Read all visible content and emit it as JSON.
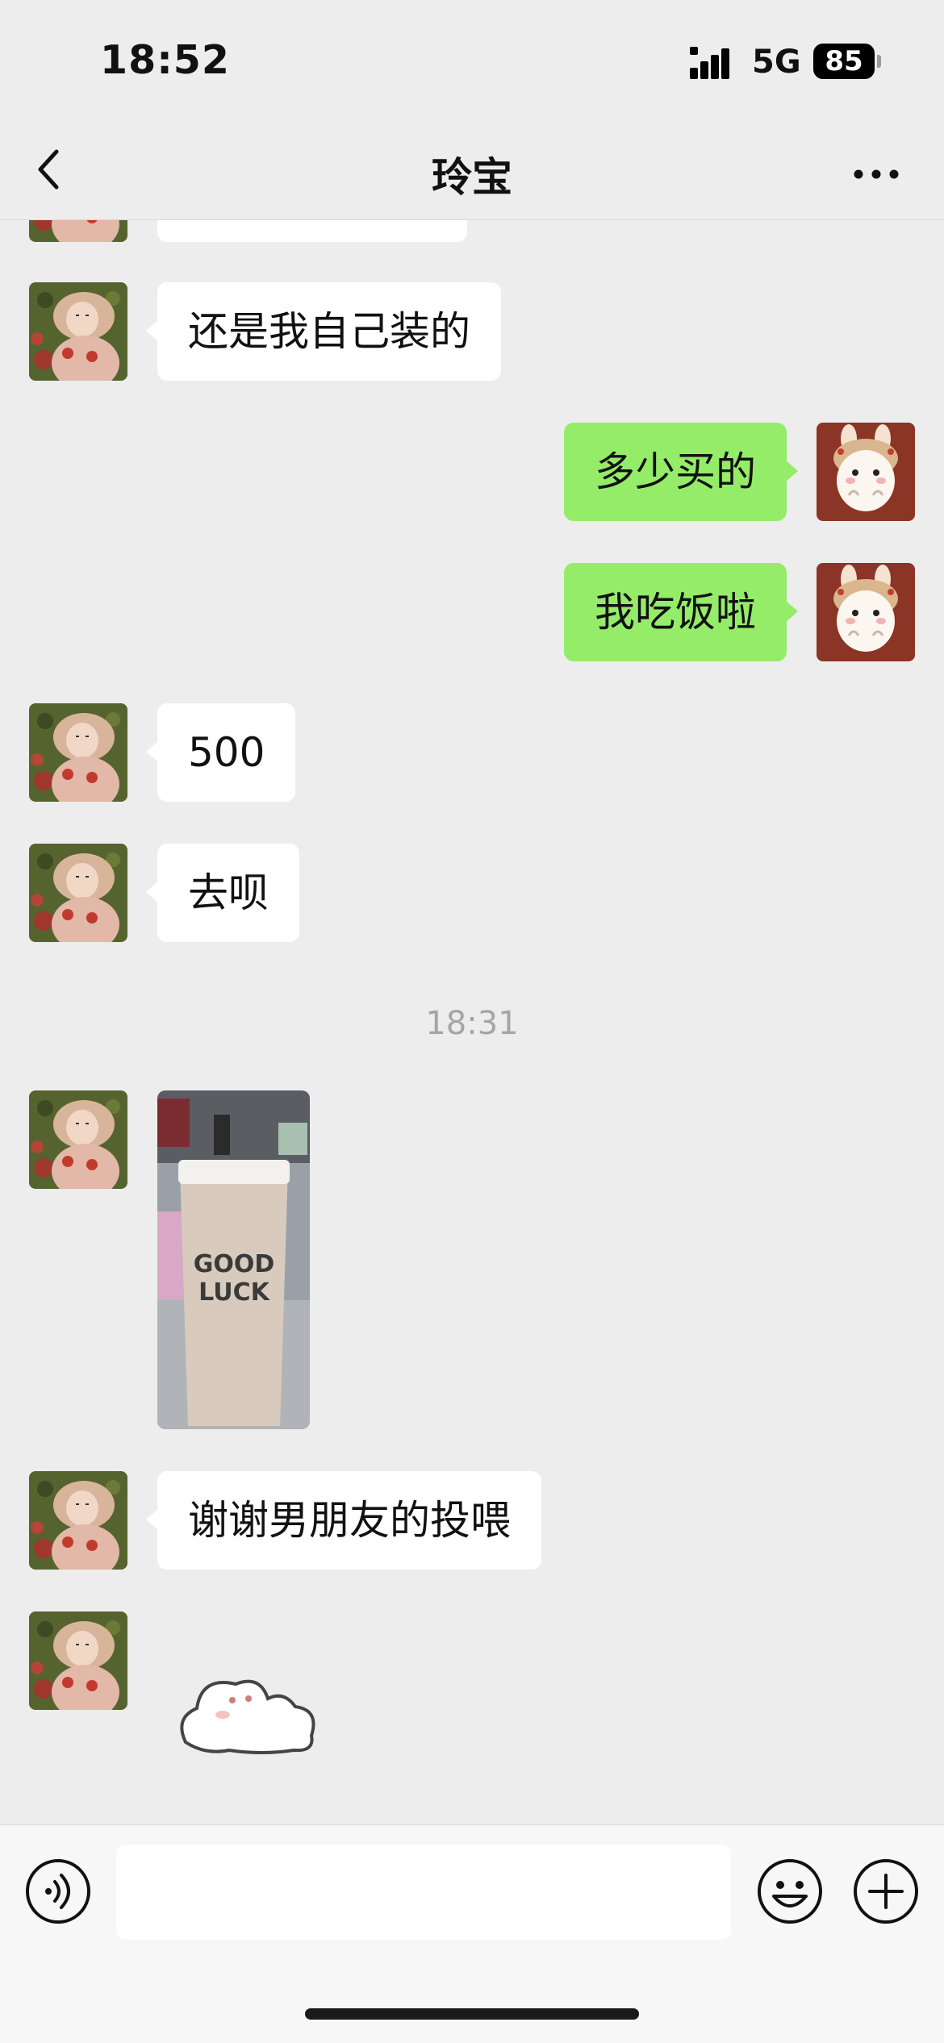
{
  "status_bar": {
    "time": "18:52",
    "network": "5G",
    "battery": "85"
  },
  "nav": {
    "title": "玲宝"
  },
  "messages": [
    {
      "side": "in",
      "text": "还是我自己装的"
    },
    {
      "side": "out",
      "text": "多少买的"
    },
    {
      "side": "out",
      "text": "我吃饭啦"
    },
    {
      "side": "in",
      "text": "500"
    },
    {
      "side": "in",
      "text": "去呗"
    },
    {
      "side": "in",
      "text": "谢谢男朋友的投喂"
    }
  ],
  "timestamp": "18:31",
  "photo": {
    "cup_text_line1": "GOOD",
    "cup_text_line2": "LUCK"
  },
  "colors": {
    "background": "#ededed",
    "bubble_out": "#95ec69",
    "bubble_in": "#ffffff"
  },
  "icons": {
    "back": "chevron-left-icon",
    "more": "more-dots-icon",
    "voice": "voice-icon",
    "emoji": "emoji-icon",
    "plus": "plus-icon"
  },
  "input": {
    "value": ""
  }
}
